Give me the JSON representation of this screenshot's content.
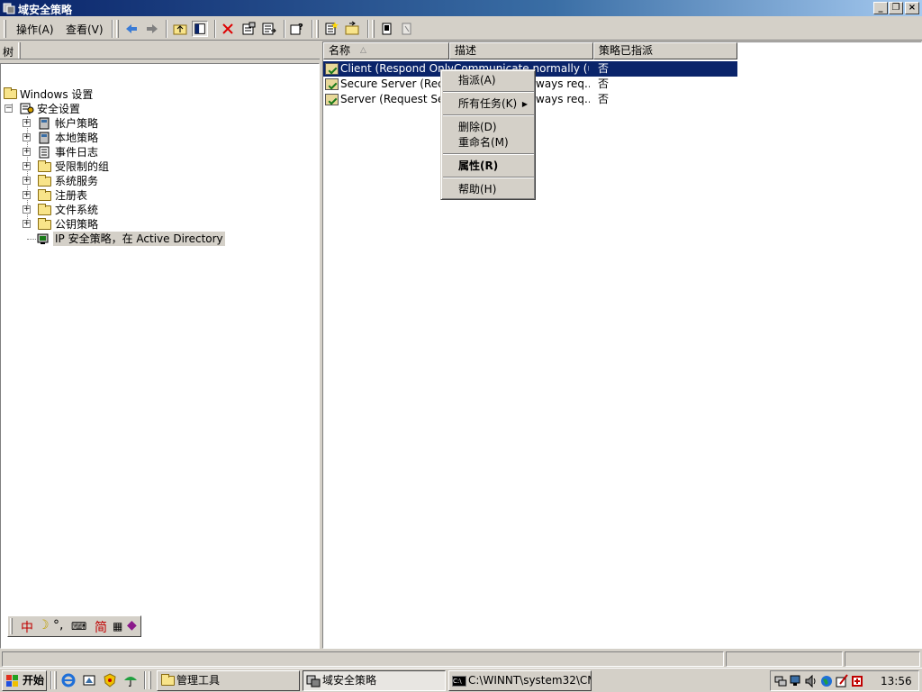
{
  "window": {
    "title": "域安全策略"
  },
  "menu": {
    "action": "操作(A)",
    "view": "查看(V)"
  },
  "tree": {
    "header": "树",
    "root": "Windows 设置",
    "security": "安全设置",
    "items": [
      "帐户策略",
      "本地策略",
      "事件日志",
      "受限制的组",
      "系统服务",
      "注册表",
      "文件系统",
      "公钥策略"
    ],
    "ipsec": "IP 安全策略，在 Active Directory"
  },
  "list": {
    "columns": [
      "名称",
      "描述",
      "策略已指派"
    ],
    "rows": [
      {
        "name": "Client (Respond Only)",
        "desc": "Communicate normally (uns...",
        "assigned": "否"
      },
      {
        "name": "Secure Server (Requir...",
        "desc": "ways req...",
        "assigned": "否"
      },
      {
        "name": "Server (Request Secu...",
        "desc": "ways req...",
        "assigned": "否"
      }
    ]
  },
  "context_menu": {
    "assign": "指派(A)",
    "all_tasks": "所有任务(K)",
    "delete": "删除(D)",
    "rename": "重命名(M)",
    "properties": "属性(R)",
    "help": "帮助(H)"
  },
  "ime": {
    "chinese": "中",
    "simplified": "简"
  },
  "taskbar": {
    "start": "开始",
    "tasks": [
      "管理工具",
      "域安全策略",
      "C:\\WINNT\\system32\\CM..."
    ],
    "clock": "13:56"
  },
  "colors": {
    "title_start": "#0a246a",
    "title_end": "#a6caf0",
    "selection": "#0a246a",
    "face": "#d4d0c8"
  }
}
